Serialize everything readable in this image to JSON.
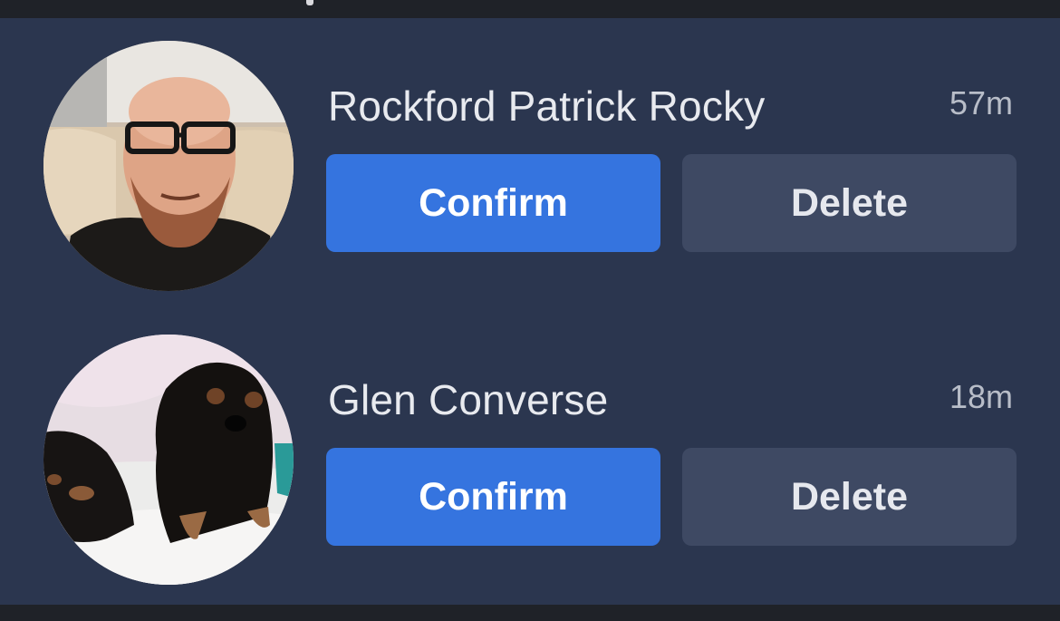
{
  "requests": [
    {
      "name": "Rockford Patrick Rocky",
      "time": "57m",
      "confirm_label": "Confirm",
      "delete_label": "Delete",
      "avatar_icon": "profile-photo-man-glasses"
    },
    {
      "name": "Glen Converse",
      "time": "18m",
      "confirm_label": "Confirm",
      "delete_label": "Delete",
      "avatar_icon": "profile-photo-dachshunds"
    }
  ],
  "colors": {
    "panel_bg": "#2b364f",
    "confirm_bg": "#3574df",
    "delete_bg": "#3e4963",
    "name_text": "#e8eaef",
    "time_text": "#b8bdc8"
  }
}
